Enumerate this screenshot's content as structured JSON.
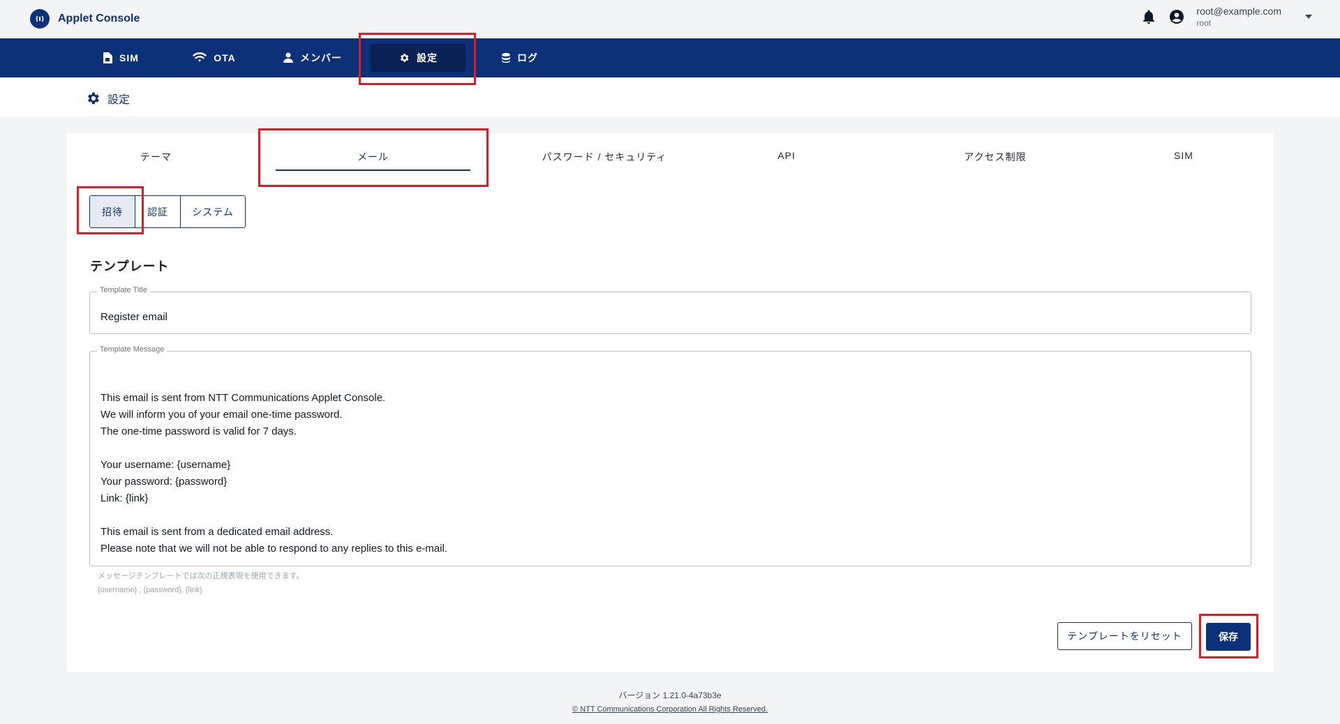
{
  "header": {
    "app_name": "Applet Console",
    "user_email": "root@example.com",
    "user_role": "root"
  },
  "nav": {
    "items": [
      {
        "label": "SIM",
        "icon": "sim-card-icon"
      },
      {
        "label": "OTA",
        "icon": "wifi-icon"
      },
      {
        "label": "メンバー",
        "icon": "person-icon"
      },
      {
        "label": "設定",
        "icon": "gear-icon",
        "active": true
      },
      {
        "label": "ログ",
        "icon": "database-icon"
      }
    ]
  },
  "breadcrumb": {
    "label": "設定"
  },
  "settings_tabs": [
    {
      "label": "テーマ"
    },
    {
      "label": "メール",
      "active": true
    },
    {
      "label": "パスワード / セキュリティ"
    },
    {
      "label": "API"
    },
    {
      "label": "アクセス制限"
    },
    {
      "label": "SIM"
    }
  ],
  "mail_subtabs": [
    {
      "label": "招待",
      "active": true
    },
    {
      "label": "認証"
    },
    {
      "label": "システム"
    }
  ],
  "template": {
    "section_title": "テンプレート",
    "title_label": "Template Title",
    "title_value": "Register email",
    "message_label": "Template Message",
    "message_lines": [
      "This email is sent from NTT Communications Applet Console.",
      "We will inform you of your email one-time password.",
      "The one-time password is valid for 7 days.",
      "",
      "Your username: {username}",
      "Your password: {password}",
      "Link: {link}",
      "",
      "This email is sent from a dedicated email address.",
      "Please note that we will not be able to respond to any replies to this e-mail."
    ],
    "helper_line1": "メッセージテンプレートでは次の正規表現を使用できます。",
    "helper_line2": "{username} , {password}, {link}"
  },
  "actions": {
    "reset_label": "テンプレートをリセット",
    "save_label": "保存"
  },
  "footer": {
    "version": "バージョン 1.21.0-4a73b3e",
    "copyright": "© NTT Communications Corporation All Rights Reserved."
  },
  "colors": {
    "brand": "#0d3178",
    "nav_active": "#0a2156",
    "highlight": "#e01b24"
  }
}
